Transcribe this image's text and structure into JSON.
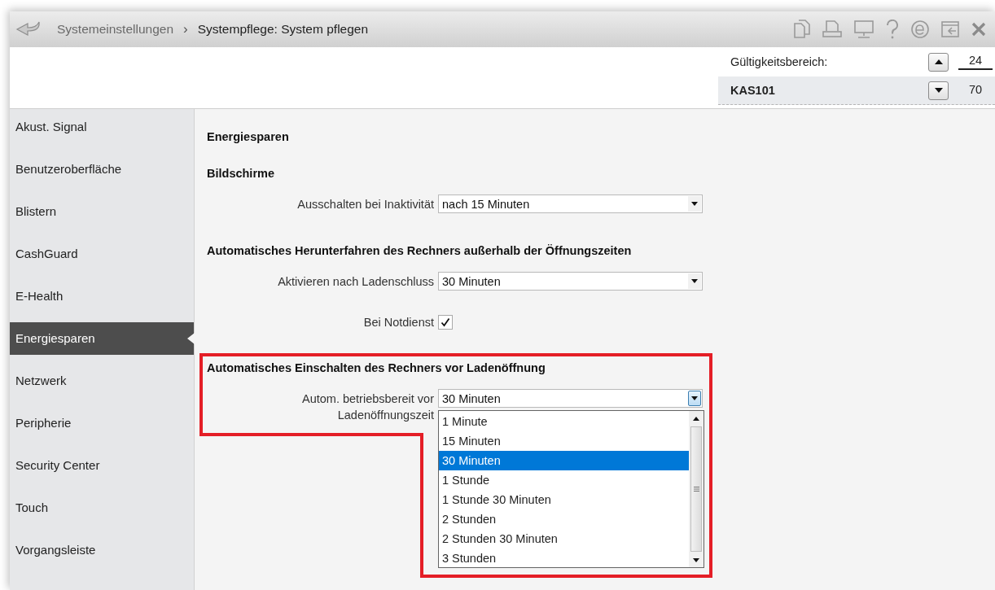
{
  "window": {
    "breadcrumb": [
      {
        "label": "Systemeinstellungen",
        "current": false
      },
      {
        "label": "Systempflege: System pflegen",
        "current": true
      }
    ],
    "separator": "›"
  },
  "scope": {
    "label": "Gültigkeitsbereich:",
    "value": "KAS101",
    "numbers": [
      "24",
      "70"
    ]
  },
  "sidebar": {
    "items": [
      {
        "label": "Akust. Signal",
        "selected": false
      },
      {
        "label": "Benutzeroberfläche",
        "selected": false
      },
      {
        "label": "Blistern",
        "selected": false
      },
      {
        "label": "CashGuard",
        "selected": false
      },
      {
        "label": "E-Health",
        "selected": false
      },
      {
        "label": "Energiesparen",
        "selected": true
      },
      {
        "label": "Netzwerk",
        "selected": false
      },
      {
        "label": "Peripherie",
        "selected": false
      },
      {
        "label": "Security Center",
        "selected": false
      },
      {
        "label": "Touch",
        "selected": false
      },
      {
        "label": "Vorgangsleiste",
        "selected": false
      }
    ]
  },
  "content": {
    "title": "Energiesparen",
    "sections": [
      {
        "heading": "Bildschirme",
        "highlighted": false,
        "fields": [
          {
            "kind": "select",
            "label": "Ausschalten bei Inaktivität",
            "value": "nach 15 Minuten",
            "expanded": false
          }
        ]
      },
      {
        "heading": "Automatisches Herunterfahren des Rechners außerhalb der Öffnungszeiten",
        "highlighted": false,
        "fields": [
          {
            "kind": "select",
            "label": "Aktivieren nach Ladenschluss",
            "value": "30 Minuten",
            "expanded": false
          },
          {
            "kind": "checkbox",
            "label": "Bei Notdienst",
            "checked": true
          }
        ]
      },
      {
        "heading": "Automatisches Einschalten des Rechners vor Ladenöffnung",
        "highlighted": true,
        "fields": [
          {
            "kind": "select",
            "label": "Autom. betriebsbereit vor Ladenöffnungszeit",
            "value": "30 Minuten",
            "expanded": true,
            "options": [
              {
                "label": "1 Minute",
                "selected": false
              },
              {
                "label": "15 Minuten",
                "selected": false
              },
              {
                "label": "30 Minuten",
                "selected": true
              },
              {
                "label": "1 Stunde",
                "selected": false
              },
              {
                "label": "1 Stunde 30 Minuten",
                "selected": false
              },
              {
                "label": "2 Stunden",
                "selected": false
              },
              {
                "label": "2 Stunden 30 Minuten",
                "selected": false
              },
              {
                "label": "3 Stunden",
                "selected": false
              }
            ]
          }
        ]
      }
    ]
  }
}
